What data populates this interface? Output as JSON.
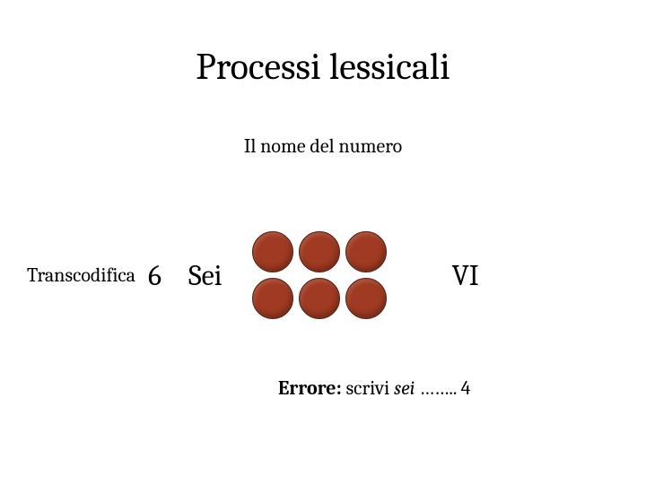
{
  "title": "Processi lessicali",
  "subtitle": "Il nome del numero",
  "row": {
    "label": "Transcodifica",
    "digit": "6",
    "word": "Sei",
    "roman": "VI"
  },
  "dots": {
    "count": 6
  },
  "error": {
    "label": "Errore:",
    "prompt": "scrivi",
    "ital": "sei",
    "dots": "……..",
    "answer": "4"
  }
}
